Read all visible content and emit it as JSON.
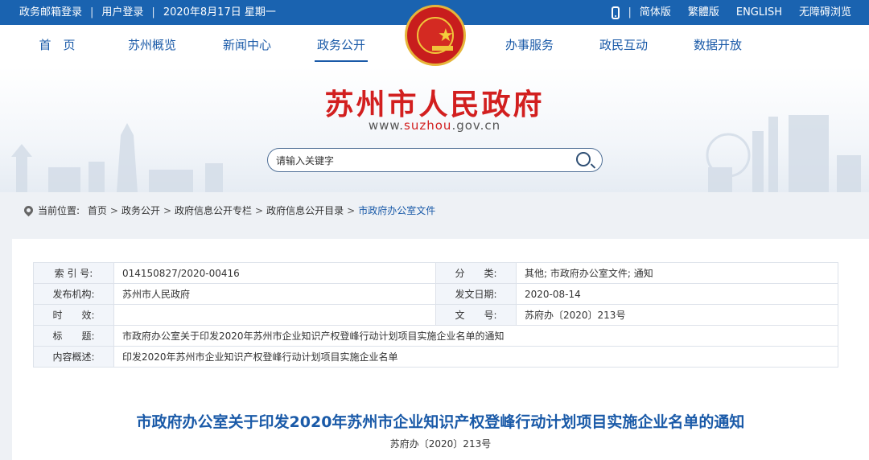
{
  "topbar": {
    "mail_login": "政务邮箱登录",
    "user_login": "用户登录",
    "date": "2020年8月17日 星期一",
    "sep": "|",
    "simplified": "简体版",
    "traditional": "繁體版",
    "english": "ENGLISH",
    "accessible": "无障碍浏览"
  },
  "nav": {
    "items": [
      "首　页",
      "苏州概览",
      "新闻中心",
      "政务公开",
      "办事服务",
      "政民互动",
      "数据开放"
    ],
    "active": "政务公开"
  },
  "banner": {
    "title": "苏州市人民政府",
    "url_prefix": "www.",
    "url_highlight": "suzhou",
    "url_suffix": ".gov.cn"
  },
  "search": {
    "placeholder": "请输入关键字"
  },
  "breadcrumb": {
    "label": "当前位置:",
    "items": [
      "首页",
      "政务公开",
      "政府信息公开专栏",
      "政府信息公开目录",
      "市政府办公室文件"
    ],
    "separator": ">"
  },
  "meta": {
    "index_label": "索 引 号:",
    "index_value": "014150827/2020-00416",
    "category_label": "分　　类:",
    "category_value": "其他;  市政府办公室文件;  通知",
    "publisher_label": "发布机构:",
    "publisher_value": "苏州市人民政府",
    "date_label": "发文日期:",
    "date_value": "2020-08-14",
    "validity_label": "时　　效:",
    "validity_value": "",
    "docno_label": "文　　号:",
    "docno_value": "苏府办〔2020〕213号",
    "title_label": "标　　题:",
    "title_value": "市政府办公室关于印发2020年苏州市企业知识产权登峰行动计划项目实施企业名单的通知",
    "summary_label": "内容概述:",
    "summary_value": "印发2020年苏州市企业知识产权登峰行动计划项目实施企业名单"
  },
  "document": {
    "title": "市政府办公室关于印发2020年苏州市企业知识产权登峰行动计划项目实施企业名单的通知",
    "number": "苏府办〔2020〕213号"
  },
  "colors": {
    "brand_blue": "#1a63b0",
    "title_red": "#d21f1f",
    "link_blue": "#1a5aa8"
  }
}
